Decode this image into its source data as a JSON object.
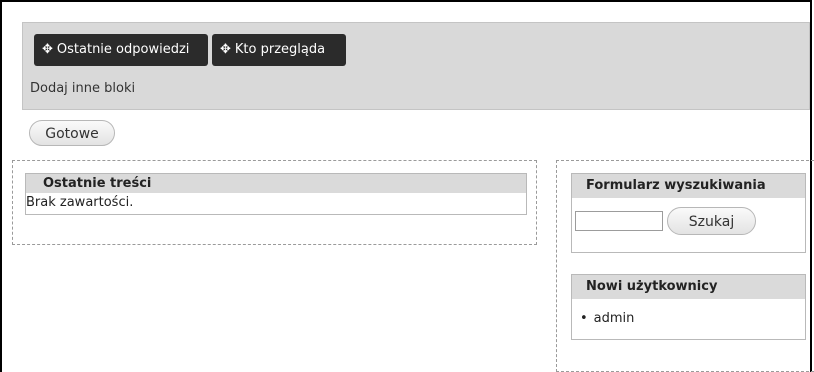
{
  "demo_region": {
    "blocks": [
      {
        "icon": "move-icon",
        "label": "Ostatnie odpowiedzi"
      },
      {
        "icon": "move-icon",
        "label": "Kto przegląda"
      }
    ],
    "add_blocks_label": "Dodaj inne bloki"
  },
  "done_button_label": "Gotowe",
  "left_region": {
    "recent_content": {
      "title": "Ostatnie treści",
      "empty_text": "Brak zawartości."
    }
  },
  "right_region": {
    "search": {
      "title": "Formularz wyszukiwania",
      "input_value": "",
      "button_label": "Szukaj"
    },
    "new_users": {
      "title": "Nowi użytkownicy",
      "items": [
        "admin"
      ]
    }
  }
}
